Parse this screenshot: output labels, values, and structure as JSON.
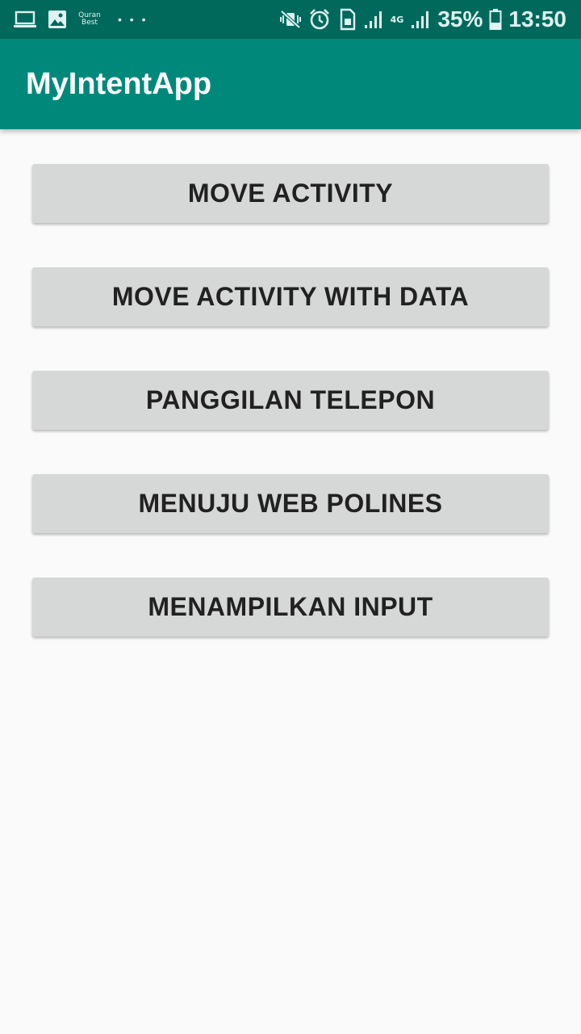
{
  "status_bar": {
    "notification_icons": [
      "laptop-icon",
      "image-icon",
      "quran-best-icon",
      "more-dots-icon"
    ],
    "quran_label_line1": "Quran",
    "quran_label_line2": "Best",
    "more_dots": "• • •",
    "system_icons": [
      "vibrate-mute-icon",
      "alarm-icon",
      "sim-icon",
      "signal-icon",
      "signal-icon"
    ],
    "network_type": "4G",
    "battery_percent": "35%",
    "time": "13:50"
  },
  "app_bar": {
    "title": "MyIntentApp",
    "color": "#00897b",
    "status_color": "#00695c"
  },
  "buttons": [
    {
      "label": "MOVE ACTIVITY"
    },
    {
      "label": "MOVE ACTIVITY WITH DATA"
    },
    {
      "label": "PANGGILAN TELEPON"
    },
    {
      "label": "MENUJU WEB POLINES"
    },
    {
      "label": "MENAMPILKAN INPUT"
    }
  ]
}
